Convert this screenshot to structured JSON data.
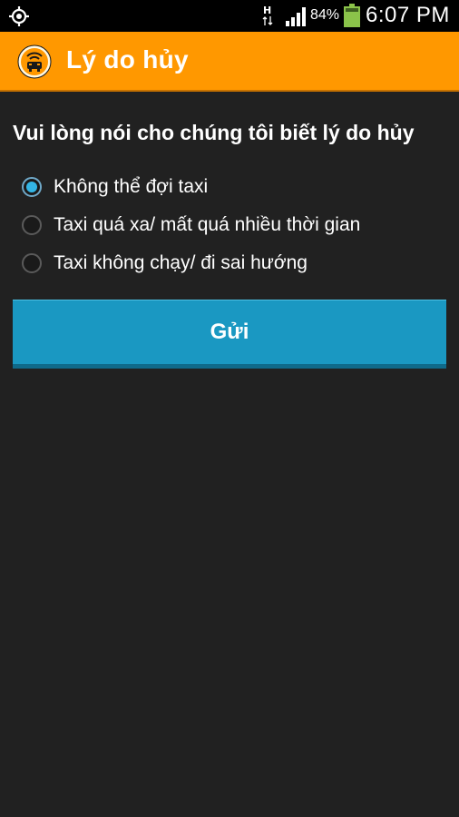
{
  "status_bar": {
    "battery_percent": "84%",
    "time": "6:07 PM",
    "icons": [
      "location-icon",
      "network-h-icon",
      "signal-icon",
      "battery-icon"
    ]
  },
  "app_bar": {
    "title": "Lý do hủy",
    "logo": "taxi-logo-icon",
    "color": "#ff9800"
  },
  "form": {
    "prompt": "Vui lòng nói cho chúng tôi biết lý do hủy",
    "options": [
      {
        "label": "Không thể đợi taxi",
        "selected": true
      },
      {
        "label": "Taxi quá xa/ mất quá nhiều thời gian",
        "selected": false
      },
      {
        "label": "Taxi không chạy/ đi sai hướng",
        "selected": false
      }
    ],
    "submit_label": "Gửi",
    "accent_color": "#33b5e5",
    "button_color": "#1a98c2"
  }
}
